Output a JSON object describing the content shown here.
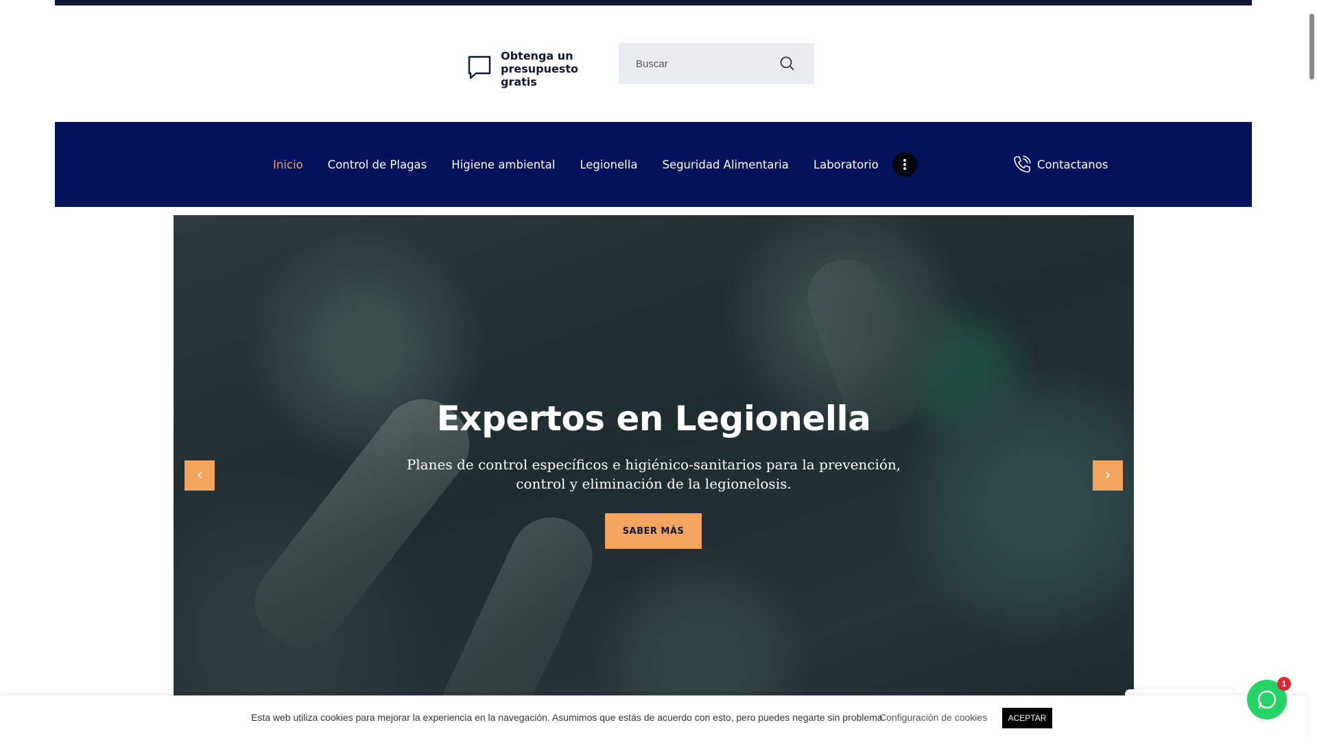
{
  "header": {
    "quote_label_line1": "Obtenga un",
    "quote_label_line2": "presupuesto gratis",
    "search_placeholder": "Buscar"
  },
  "nav": {
    "items": [
      {
        "label": "Inicio",
        "active": true
      },
      {
        "label": "Control de Plagas",
        "active": false
      },
      {
        "label": "Higiene ambiental",
        "active": false
      },
      {
        "label": "Legionella",
        "active": false
      },
      {
        "label": "Seguridad Alimentaria",
        "active": false
      },
      {
        "label": "Laboratorio",
        "active": false
      }
    ],
    "more_icon": "vertical-dots-icon",
    "contact_label": "Contactanos",
    "contact_icon": "phone-icon"
  },
  "hero": {
    "title": "Expertos en Legionella",
    "subtitle": "Planes de control específicos e higiénico-sanitarios para la prevención, control y eliminación de la legionelosis.",
    "cta_label": "SABER MÁS",
    "prev_arrow": "‹",
    "next_arrow": "›"
  },
  "cookie": {
    "text": "Esta web utiliza cookies para mejorar la experiencia en la navegación. Asumimos que estás de acuerdo con esto, pero puedes negarte sin problema.",
    "config_label": "Configuración de cookies",
    "accept_label": "ACEPTAR"
  },
  "whatsapp": {
    "badge_count": "1"
  },
  "colors": {
    "nav_bg": "#03135b",
    "accent": "#f3a45e",
    "dark": "#0b1733",
    "whatsapp": "#25d366",
    "badge": "#e3262e"
  }
}
